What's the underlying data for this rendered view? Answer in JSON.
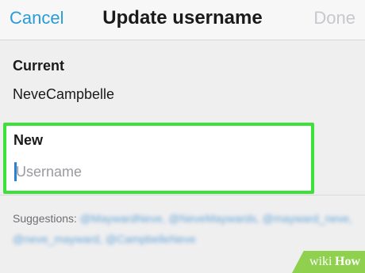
{
  "nav": {
    "cancel_label": "Cancel",
    "title": "Update username",
    "done_label": "Done"
  },
  "current": {
    "label": "Current",
    "value": "NeveCampbelle"
  },
  "new": {
    "label": "New",
    "placeholder": "Username",
    "value": ""
  },
  "suggestions": {
    "label": "Suggestions:",
    "items": [
      "@MaywardNeve,",
      "@NeveMaywards,",
      "@mayward_neve,",
      "@neve_mayward,",
      "@CampbelleNeve"
    ]
  },
  "watermark": {
    "wiki": "wiki",
    "how": "How"
  },
  "colors": {
    "accent": "#2a9bd6",
    "highlight": "#3ee03a",
    "disabled": "#c7c7cc"
  }
}
